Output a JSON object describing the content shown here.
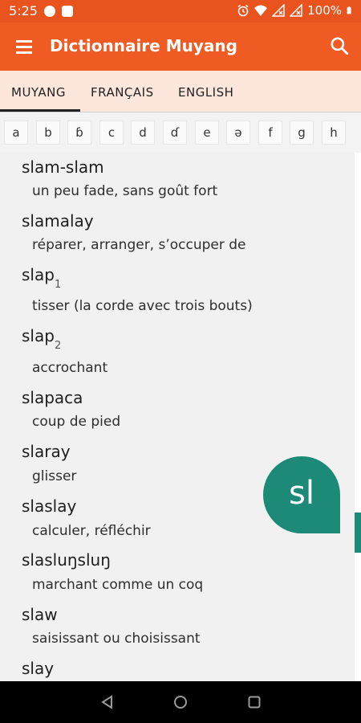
{
  "status": {
    "time": "5:25",
    "battery": "100%"
  },
  "appbar": {
    "title": "Dictionnaire Muyang",
    "menu_icon": "hamburger-menu-icon",
    "search_icon": "search-icon"
  },
  "tabs": [
    {
      "label": "MUYANG"
    },
    {
      "label": "FRANÇAIS"
    },
    {
      "label": "ENGLISH"
    }
  ],
  "alphabet": [
    "a",
    "b",
    "ɓ",
    "c",
    "d",
    "ɗ",
    "e",
    "ə",
    "f",
    "g",
    "h"
  ],
  "entries": [
    {
      "word": "slam-slam",
      "sub": "",
      "gloss": "un peu fade, sans goût fort"
    },
    {
      "word": "slamalay",
      "sub": "",
      "gloss": "réparer, arranger, s’occuper de"
    },
    {
      "word": "slap",
      "sub": "1",
      "gloss": "tisser (la corde avec trois bouts)"
    },
    {
      "word": "slap",
      "sub": "2",
      "gloss": "accrochant"
    },
    {
      "word": "slapaca",
      "sub": "",
      "gloss": "coup de pied"
    },
    {
      "word": "slaray",
      "sub": "",
      "gloss": "glisser"
    },
    {
      "word": "slaslay",
      "sub": "",
      "gloss": "calculer, réfléchir"
    },
    {
      "word": "slasluŋsluŋ",
      "sub": "",
      "gloss": "marchant comme un coq"
    },
    {
      "word": "slaw",
      "sub": "",
      "gloss": "saisissant ou choisissant"
    },
    {
      "word": "slay",
      "sub": "",
      "gloss": ""
    }
  ],
  "fast_scroll_bubble": "sl",
  "colors": {
    "primary": "#f05a23",
    "statusbar": "#e8531e",
    "tab_bg": "#fde7dc",
    "accent": "#1d8a77"
  }
}
